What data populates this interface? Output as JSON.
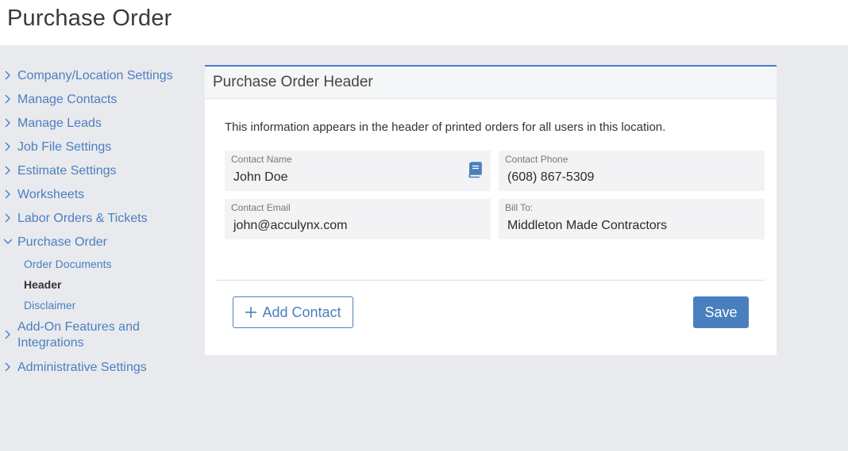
{
  "page": {
    "title": "Purchase Order"
  },
  "sidebar": {
    "items": [
      {
        "label": "Company/Location Settings"
      },
      {
        "label": "Manage Contacts"
      },
      {
        "label": "Manage Leads"
      },
      {
        "label": "Job File Settings"
      },
      {
        "label": "Estimate Settings"
      },
      {
        "label": "Worksheets"
      },
      {
        "label": "Labor Orders & Tickets"
      },
      {
        "label": "Purchase Order"
      },
      {
        "label_line1": "Add-On Features and",
        "label_line2": "Integrations"
      },
      {
        "label": "Administrative Settings"
      }
    ],
    "purchase_order_sub": [
      {
        "label": "Order Documents"
      },
      {
        "label": "Header"
      },
      {
        "label": "Disclaimer"
      }
    ]
  },
  "card": {
    "title": "Purchase Order Header",
    "info": "This information appears in the header of printed orders for all users in this location.",
    "fields": {
      "contact_name": {
        "label": "Contact Name",
        "value": "John Doe"
      },
      "contact_phone": {
        "label": "Contact Phone",
        "value": "(608) 867-5309"
      },
      "contact_email": {
        "label": "Contact Email",
        "value": "john@acculynx.com"
      },
      "bill_to": {
        "label": "Bill To:",
        "value": "Middleton Made Contractors"
      }
    },
    "add_contact_label": "Add Contact",
    "save_label": "Save"
  },
  "icons": {
    "chevron": "chevron-right-icon",
    "chevron_open": "chevron-down-icon",
    "book": "address-book-icon",
    "plus": "plus-icon"
  },
  "colors": {
    "accent": "#4a7fbf",
    "background": "#e9eaee",
    "field_bg": "#f3f3f5"
  }
}
